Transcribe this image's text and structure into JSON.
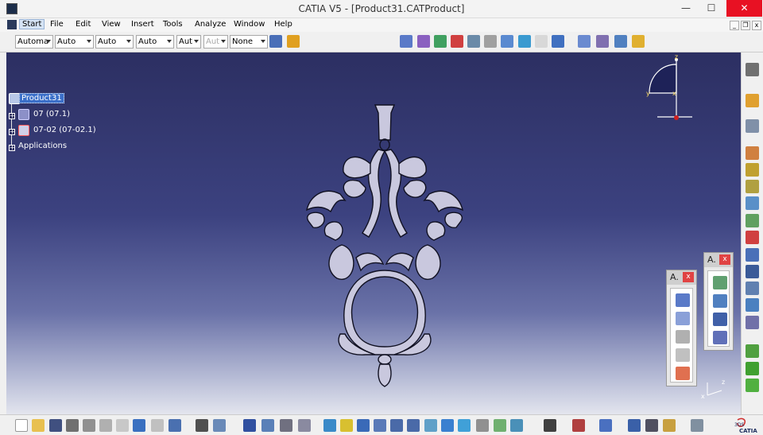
{
  "window": {
    "title": "CATIA V5 - [Product31.CATProduct]",
    "minimize_glyph": "—",
    "maximize_glyph": "☐",
    "close_glyph": "✕"
  },
  "menubar": {
    "items": [
      {
        "label": "Start",
        "key": "S"
      },
      {
        "label": "File",
        "key": "F"
      },
      {
        "label": "Edit",
        "key": "E"
      },
      {
        "label": "View",
        "key": "V"
      },
      {
        "label": "Insert",
        "key": "I"
      },
      {
        "label": "Tools",
        "key": "T"
      },
      {
        "label": "Analyze",
        "key": "A"
      },
      {
        "label": "Window",
        "key": "W"
      },
      {
        "label": "Help",
        "key": "H"
      }
    ],
    "mdi_min": "_",
    "mdi_restore": "❐",
    "mdi_close": "x"
  },
  "toolbar_top": {
    "combos": [
      {
        "value": "Automa",
        "disabled": false
      },
      {
        "value": "Auto",
        "disabled": false
      },
      {
        "value": "Auto",
        "disabled": false
      },
      {
        "value": "Auto",
        "disabled": false
      },
      {
        "value": "Aut",
        "disabled": false
      },
      {
        "value": "Aut",
        "disabled": true
      },
      {
        "value": "None",
        "disabled": false
      }
    ]
  },
  "tree": {
    "root": "Product31",
    "children": [
      {
        "label": "07 (07.1)"
      },
      {
        "label": "07-02 (07-02.1)"
      }
    ],
    "applications": "Applications"
  },
  "compass": {
    "x_label": "x",
    "y_label": "y",
    "z_label": "z"
  },
  "floating_toolbars": [
    {
      "title": "A.",
      "close": "x"
    },
    {
      "title": "A.",
      "close": "x"
    }
  ],
  "axis_triad": {
    "x_label": "x",
    "z_label": "z"
  },
  "logo": {
    "text": "CATIA",
    "mark": "3DS"
  },
  "colors": {
    "accent": "#3b6fc9",
    "close_red": "#e81123",
    "viewport_top": "#2c2f62",
    "model_fill": "#c9c8de",
    "model_stroke": "#111122"
  }
}
